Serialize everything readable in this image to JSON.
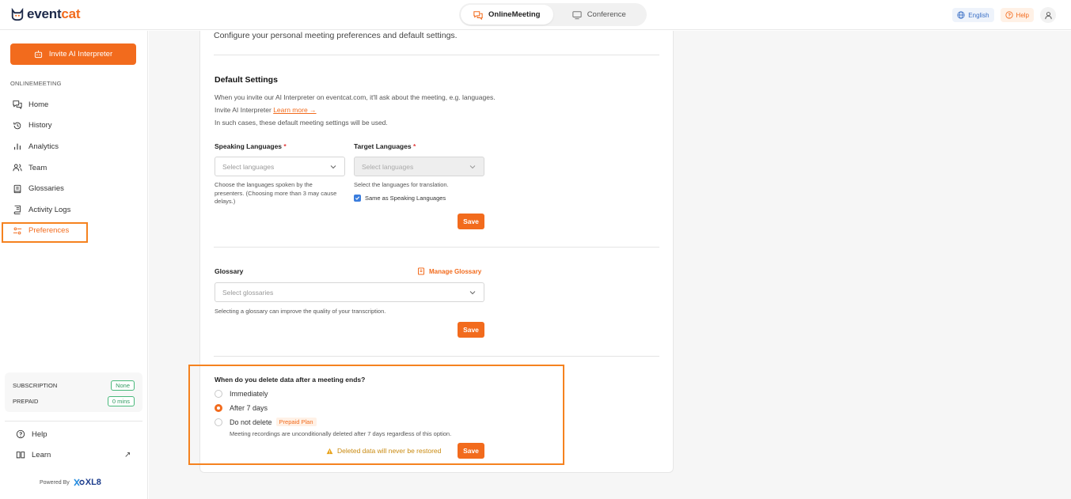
{
  "brand": {
    "name_a": "event",
    "name_b": "cat"
  },
  "topbar": {
    "modes": [
      {
        "label": "OnlineMeeting",
        "active": true
      },
      {
        "label": "Conference",
        "active": false
      }
    ],
    "language": "English",
    "help": "Help"
  },
  "sidebar": {
    "invite_label": "Invite AI Interpreter",
    "section_label": "ONLINEMEETING",
    "items": [
      {
        "label": "Home",
        "icon": "chat-icon"
      },
      {
        "label": "History",
        "icon": "history-icon"
      },
      {
        "label": "Analytics",
        "icon": "bar-chart-icon"
      },
      {
        "label": "Team",
        "icon": "users-icon"
      },
      {
        "label": "Glossaries",
        "icon": "book-icon"
      },
      {
        "label": "Activity Logs",
        "icon": "log-icon"
      },
      {
        "label": "Preferences",
        "icon": "sliders-icon",
        "active": true
      }
    ],
    "subscription_label": "SUBSCRIPTION",
    "subscription_value": "None",
    "prepaid_label": "PREPAID",
    "prepaid_value": "0 mins",
    "help_label": "Help",
    "learn_label": "Learn",
    "powered_by": "Powered By",
    "powered_brand": "XL8"
  },
  "main": {
    "intro": "Configure your personal meeting preferences and default settings.",
    "default_settings": {
      "title": "Default Settings",
      "line1": "When you invite our AI Interpreter on eventcat.com, it'll ask about the meeting, e.g. languages.",
      "line2_text": "Invite AI Interpreter",
      "line2_link": "Learn more →",
      "line3": "In such cases, these default meeting settings will be used.",
      "speaking_label": "Speaking Languages",
      "speaking_placeholder": "Select languages",
      "speaking_help_1": "Choose the languages spoken by the",
      "speaking_help_2": "presenters. (Choosing more than 3 may cause",
      "speaking_help_3": "delays.)",
      "target_label": "Target Languages",
      "target_placeholder": "Select languages",
      "target_help": "Select the languages for translation.",
      "same_as": "Same as Speaking Languages",
      "required_mark": "*",
      "save": "Save"
    },
    "glossary": {
      "title": "Glossary",
      "manage": "Manage Glossary",
      "placeholder": "Select glossaries",
      "help": "Selecting a glossary can improve the quality of your transcription.",
      "save": "Save"
    },
    "deletion": {
      "title": "When do you delete data after a meeting ends?",
      "options": [
        {
          "label": "Immediately",
          "selected": false
        },
        {
          "label": "After 7 days",
          "selected": true
        },
        {
          "label": "Do not delete",
          "selected": false,
          "tag": "Prepaid Plan"
        }
      ],
      "note": "Meeting recordings are unconditionally deleted after 7 days regardless of this option.",
      "warning": "Deleted data will never be restored",
      "save": "Save"
    }
  },
  "colors": {
    "accent": "#f26b1d",
    "highlight": "#f5821f",
    "success": "#48b87a",
    "link_blue": "#3a6fc5"
  }
}
